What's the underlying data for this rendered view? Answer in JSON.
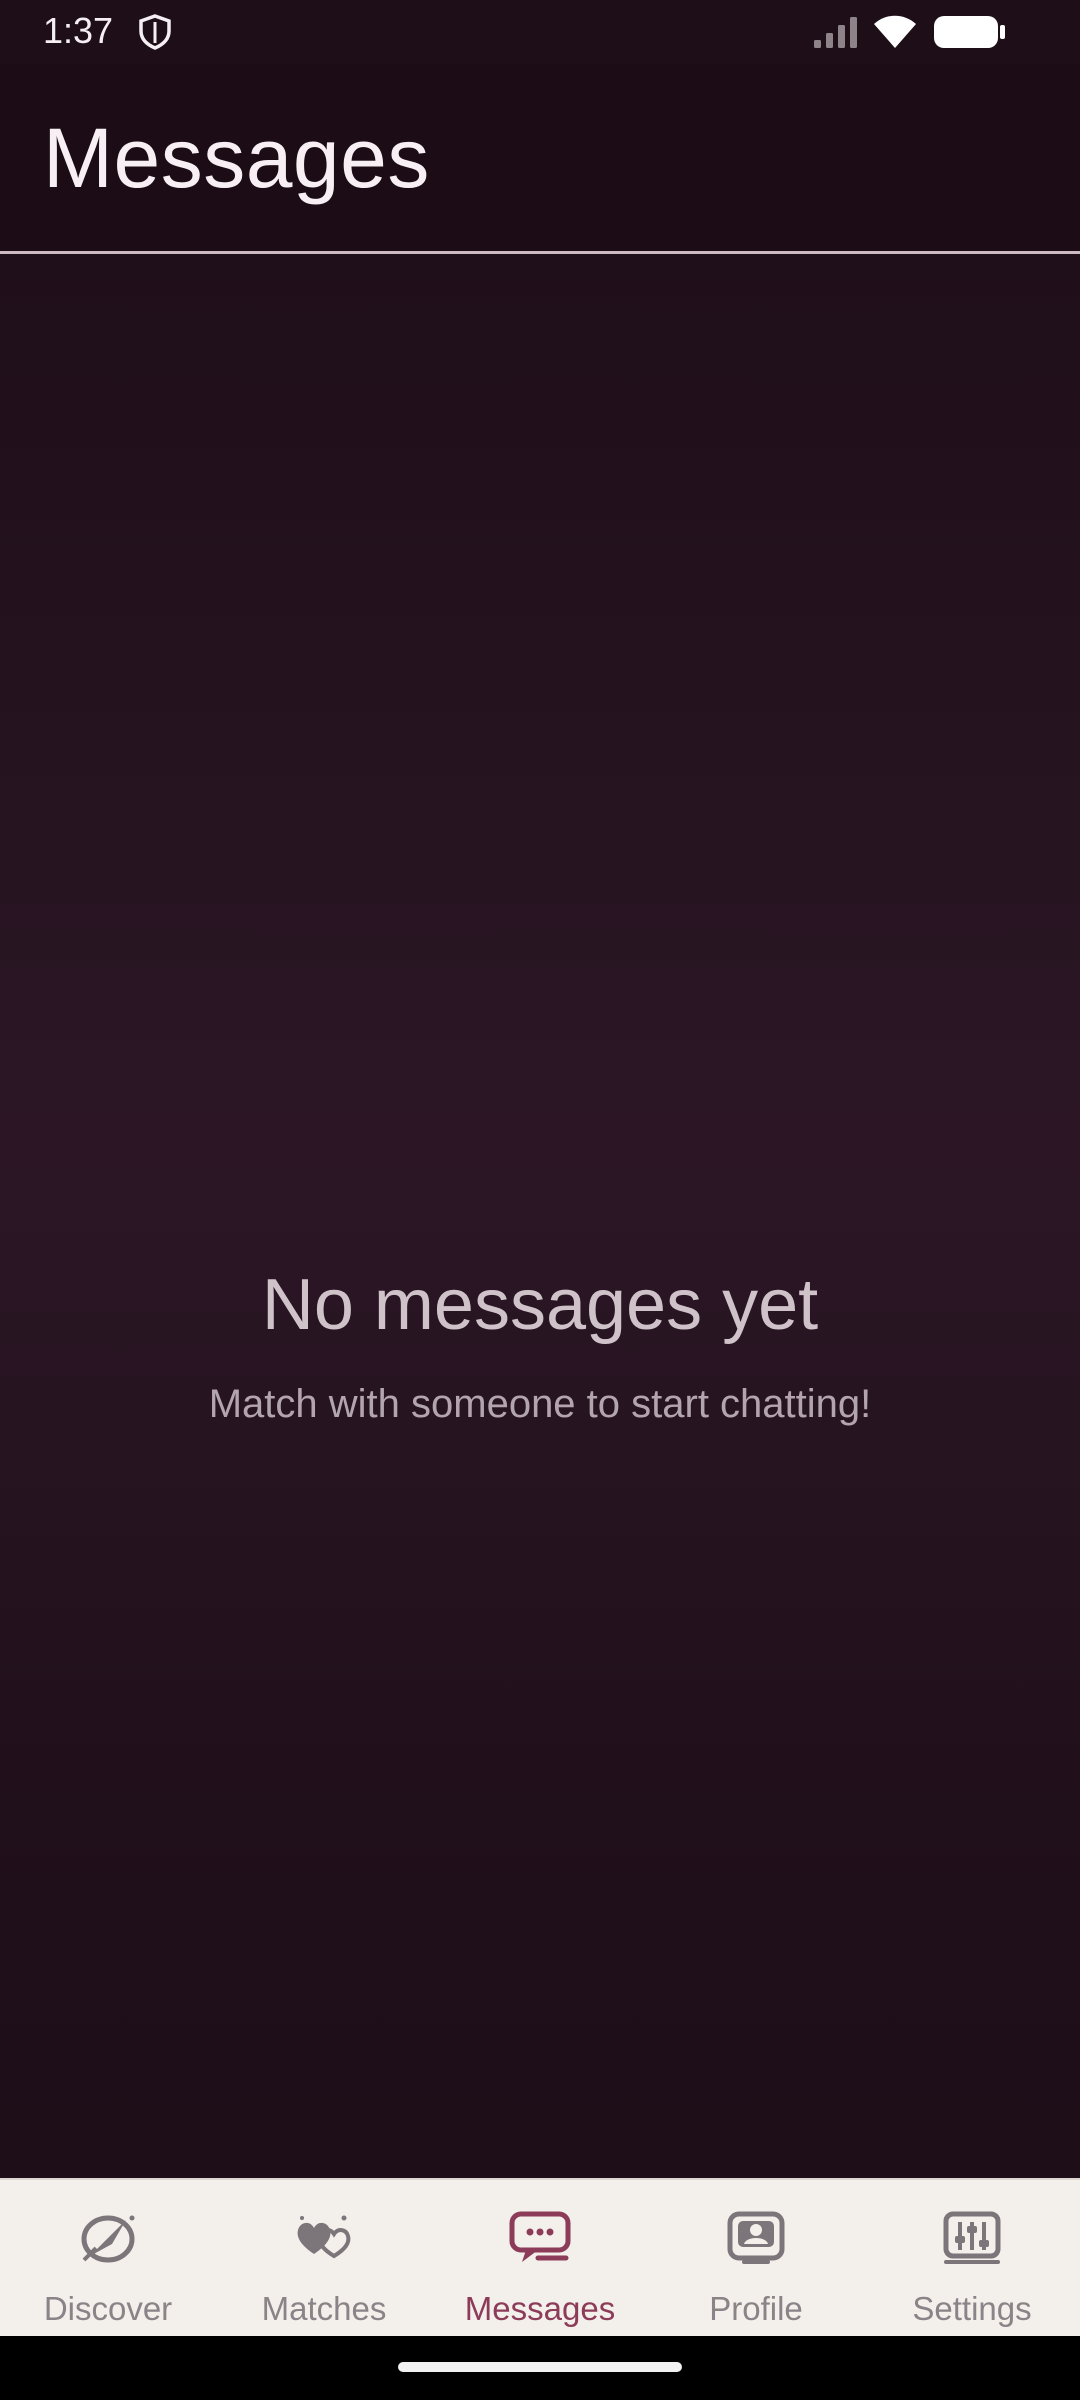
{
  "status_bar": {
    "time": "1:37",
    "icons": [
      "shield-icon",
      "signal-icon",
      "wifi-icon",
      "battery-icon"
    ]
  },
  "header": {
    "title": "Messages"
  },
  "empty_state": {
    "title": "No messages yet",
    "subtitle": "Match with someone to start chatting!"
  },
  "bottom_nav": {
    "active": "Messages",
    "items": [
      {
        "label": "Discover",
        "icon": "compass-icon"
      },
      {
        "label": "Matches",
        "icon": "hearts-icon"
      },
      {
        "label": "Messages",
        "icon": "chat-bubble-icon"
      },
      {
        "label": "Profile",
        "icon": "profile-card-icon"
      },
      {
        "label": "Settings",
        "icon": "sliders-icon"
      }
    ]
  },
  "colors": {
    "background": "#1d0e18",
    "header_text": "#f7eff3",
    "divider": "#cdb9c2",
    "nav_background": "#f3efeb",
    "nav_inactive": "#8a8387",
    "nav_active": "#8c3b59"
  }
}
